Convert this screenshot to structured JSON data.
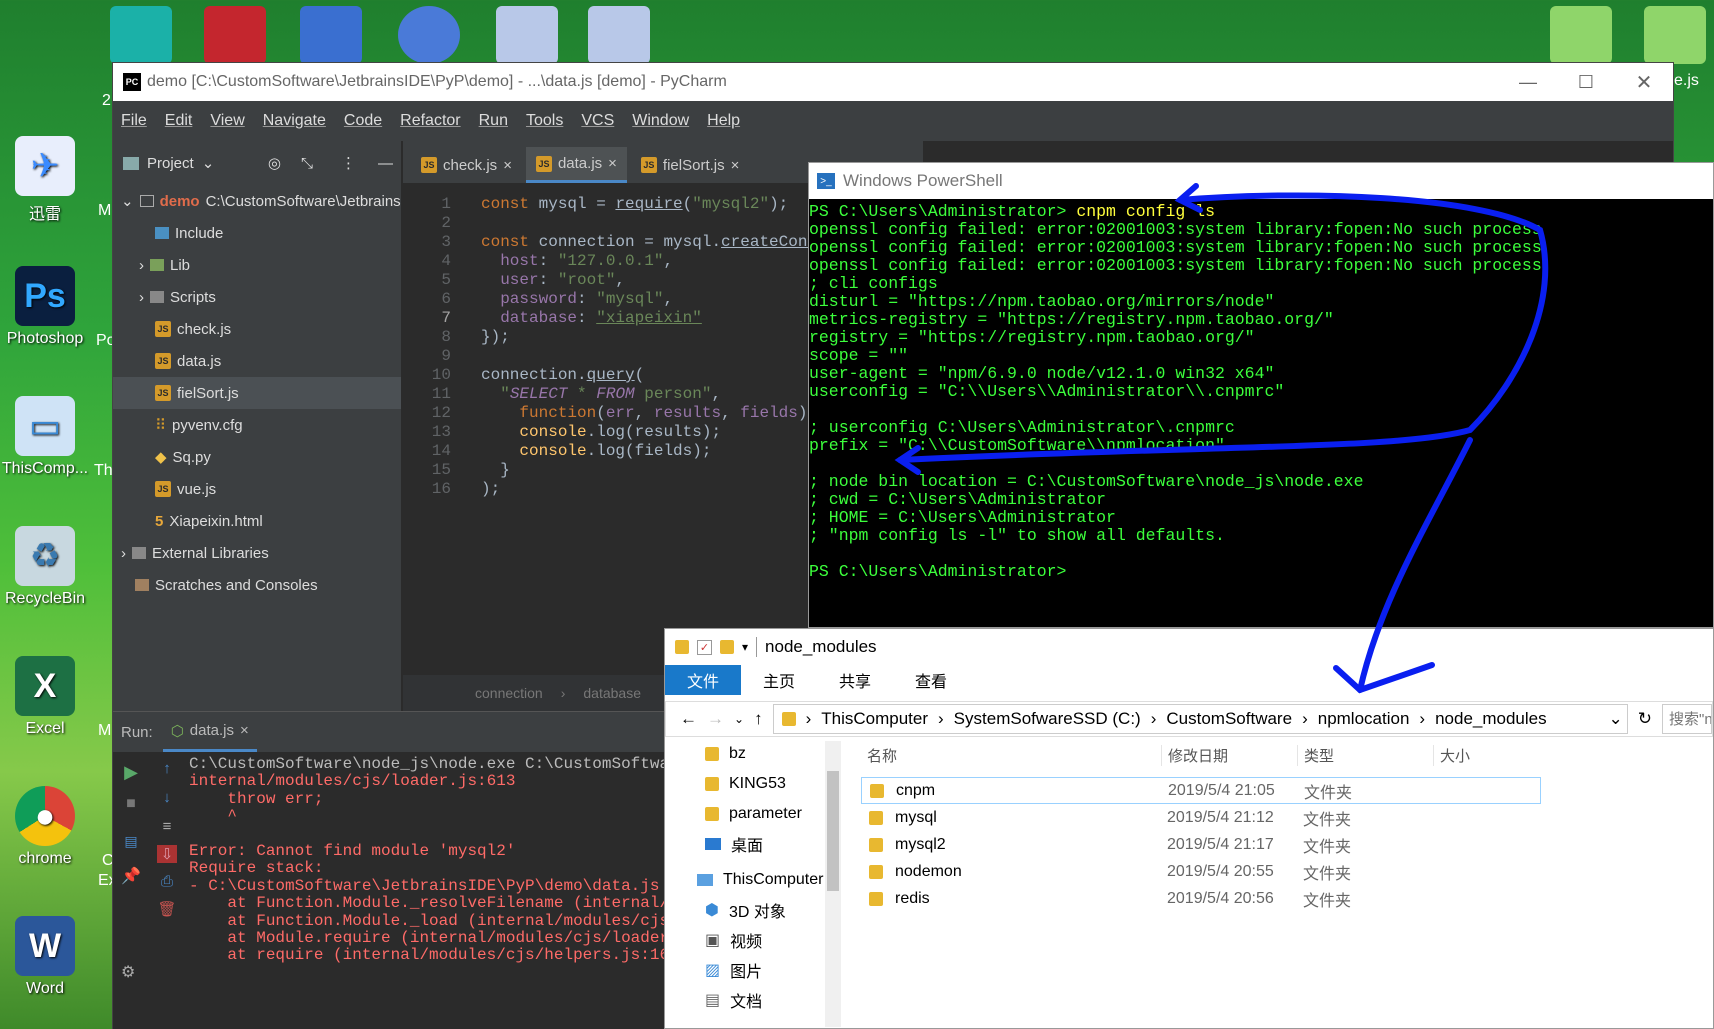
{
  "desktop": {
    "icons": [
      {
        "label": "迅雷",
        "name": "xunlei-icon",
        "color": "#3b8bff",
        "glyph": "✈"
      },
      {
        "label": "Photoshop",
        "name": "photoshop-icon",
        "color": "#0a1f3f",
        "glyph": "Ps"
      },
      {
        "label": "ThisComp...",
        "name": "this-computer-icon",
        "color": "#3a8ad6",
        "glyph": "🖥"
      },
      {
        "label": "RecycleBin",
        "name": "recycle-bin-icon",
        "color": "#7ab",
        "glyph": "♻"
      },
      {
        "label": "Excel",
        "name": "excel-icon",
        "color": "#1d7044",
        "glyph": "X"
      },
      {
        "label": "chrome",
        "name": "chrome-icon",
        "color": "#e04030",
        "glyph": "◉"
      },
      {
        "label": "Word",
        "name": "word-icon",
        "color": "#2b579a",
        "glyph": "W"
      }
    ],
    "partial_labels": {
      "m1": "M",
      "m2": "Po",
      "m3": "Th",
      "m4": "M",
      "m5": "C",
      "m6": "Ex",
      "m7": "2",
      "right": "e.js"
    }
  },
  "pycharm": {
    "title": "demo [C:\\CustomSoftware\\JetbrainsIDE\\PyP\\demo] - ...\\data.js [demo] - PyCharm",
    "menu": [
      "File",
      "Edit",
      "View",
      "Navigate",
      "Code",
      "Refactor",
      "Run",
      "Tools",
      "VCS",
      "Window",
      "Help"
    ],
    "project_label": "Project",
    "tree": {
      "root_name": "demo",
      "root_path": "C:\\CustomSoftware\\Jetbrains",
      "items": [
        "Include",
        "Lib",
        "Scripts",
        "check.js",
        "data.js",
        "fielSort.js",
        "pyvenv.cfg",
        "Sq.py",
        "vue.js",
        "Xiapeixin.html"
      ],
      "external": "External Libraries",
      "scratches": "Scratches and Consoles"
    },
    "tabs": [
      "check.js",
      "data.js",
      "fielSort.js"
    ],
    "line_numbers": [
      "1",
      "2",
      "3",
      "4",
      "5",
      "6",
      "7",
      "8",
      "9",
      "10",
      "11",
      "12",
      "13",
      "14",
      "15",
      "16"
    ],
    "breadcrumb": [
      "connection",
      "database"
    ],
    "run": {
      "label": "Run:",
      "tab": "data.js",
      "lines": [
        {
          "text": "C:\\CustomSoftware\\node_js\\node.exe C:\\CustomSoftwar",
          "err": false
        },
        {
          "text": "internal/modules/cjs/loader.js:613",
          "err": true
        },
        {
          "text": "    throw err;",
          "err": true
        },
        {
          "text": "    ^",
          "err": true
        },
        {
          "text": "",
          "err": true
        },
        {
          "text": "Error: Cannot find module 'mysql2'",
          "err": true
        },
        {
          "text": "Require stack:",
          "err": true
        },
        {
          "text": "- C:\\CustomSoftware\\JetbrainsIDE\\PyP\\demo\\data.js",
          "err": true
        },
        {
          "text": "    at Function.Module._resolveFilename (internal/m",
          "err": true
        },
        {
          "text": "    at Function.Module._load (internal/modules/cjs/",
          "err": true
        },
        {
          "text": "    at Module.require (internal/modules/cjs/loader.",
          "err": true
        },
        {
          "text": "    at require (internal/modules/cjs/helpers.js:16:",
          "err": true
        }
      ]
    }
  },
  "powershell": {
    "title": "Windows PowerShell",
    "prompt": "PS C:\\Users\\Administrator> ",
    "command": "cnpm config ls",
    "lines": [
      "openssl config failed: error:02001003:system library:fopen:No such process",
      "openssl config failed: error:02001003:system library:fopen:No such process",
      "openssl config failed: error:02001003:system library:fopen:No such process",
      "; cli configs",
      "disturl = \"https://npm.taobao.org/mirrors/node\"",
      "metrics-registry = \"https://registry.npm.taobao.org/\"",
      "registry = \"https://registry.npm.taobao.org/\"",
      "scope = \"\"",
      "user-agent = \"npm/6.9.0 node/v12.1.0 win32 x64\"",
      "userconfig = \"C:\\\\Users\\\\Administrator\\\\.cnpmrc\"",
      "",
      "; userconfig C:\\Users\\Administrator\\.cnpmrc",
      "prefix = \"C:\\\\CustomSoftware\\\\npmlocation\"",
      "",
      "; node bin location = C:\\CustomSoftware\\node_js\\node.exe",
      "; cwd = C:\\Users\\Administrator",
      "; HOME = C:\\Users\\Administrator",
      "; \"npm config ls -l\" to show all defaults.",
      "",
      "PS C:\\Users\\Administrator>"
    ]
  },
  "explorer": {
    "title": "node_modules",
    "ribbon": [
      "文件",
      "主页",
      "共享",
      "查看"
    ],
    "path": [
      "ThisComputer",
      "SystemSofwareSSD (C:)",
      "CustomSoftware",
      "npmlocation",
      "node_modules"
    ],
    "search_placeholder": "搜索\"n",
    "nav": [
      "bz",
      "KING53",
      "parameter",
      "桌面",
      "ThisComputer",
      "3D 对象",
      "视频",
      "图片",
      "文档"
    ],
    "columns": [
      "名称",
      "修改日期",
      "类型",
      "大小"
    ],
    "files": [
      {
        "name": "cnpm",
        "date": "2019/5/4 21:05",
        "type": "文件夹"
      },
      {
        "name": "mysql",
        "date": "2019/5/4 21:12",
        "type": "文件夹"
      },
      {
        "name": "mysql2",
        "date": "2019/5/4 21:17",
        "type": "文件夹"
      },
      {
        "name": "nodemon",
        "date": "2019/5/4 20:55",
        "type": "文件夹"
      },
      {
        "name": "redis",
        "date": "2019/5/4 20:56",
        "type": "文件夹"
      }
    ]
  }
}
